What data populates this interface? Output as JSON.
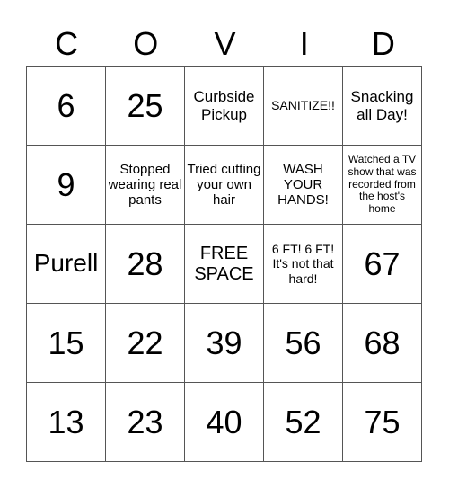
{
  "title_letters": [
    "C",
    "O",
    "V",
    "I",
    "D"
  ],
  "card": [
    [
      "6",
      "25",
      "Curbside Pickup",
      "SANITIZE!!",
      "Snacking all Day!"
    ],
    [
      "9",
      "Stopped wearing real pants",
      "Tried cutting your own hair",
      "WASH YOUR HANDS!",
      "Watched a TV show that was recorded from the host's home"
    ],
    [
      "Purell",
      "28",
      "FREE SPACE",
      "6 FT! 6 FT! It's not that hard!",
      "67"
    ],
    [
      "15",
      "22",
      "39",
      "56",
      "68"
    ],
    [
      "13",
      "23",
      "40",
      "52",
      "75"
    ]
  ]
}
